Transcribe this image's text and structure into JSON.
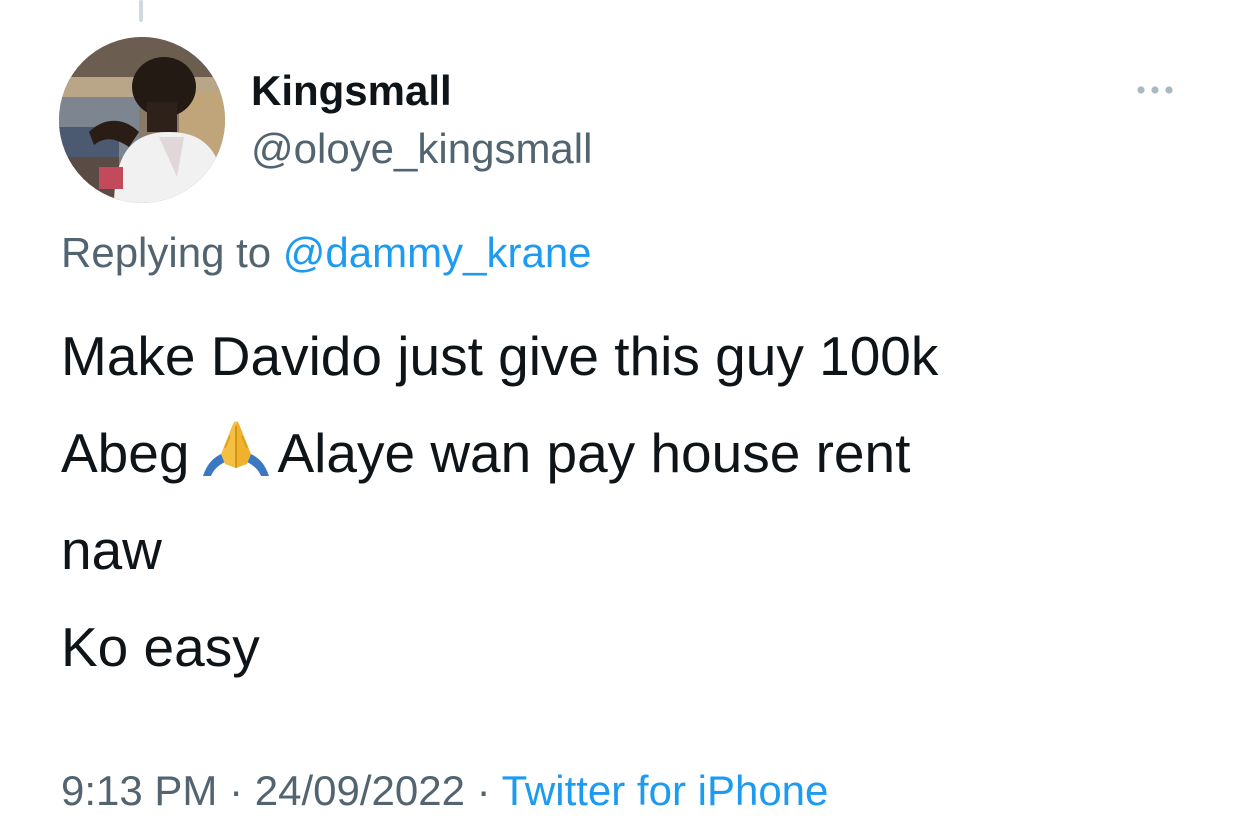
{
  "author": {
    "display_name": "Kingsmall",
    "handle": "@oloye_kingsmall"
  },
  "reply": {
    "prefix": "Replying to",
    "mention": "@dammy_krane"
  },
  "tweet": {
    "line1": "Make Davido just give  this guy 100k",
    "line2_before": "Abeg",
    "emoji_icon": "folded-hands-icon",
    "line2_after": "Alaye wan pay house rent",
    "line3": "naw",
    "line4": "Ko easy"
  },
  "meta": {
    "time": "9:13 PM",
    "sep1": "·",
    "date": "24/09/2022",
    "sep2": "·",
    "source": "Twitter for iPhone"
  },
  "colors": {
    "text_primary": "#0f1419",
    "text_secondary": "#536471",
    "link": "#1d9bf0",
    "thread_line": "#cfd9de"
  }
}
